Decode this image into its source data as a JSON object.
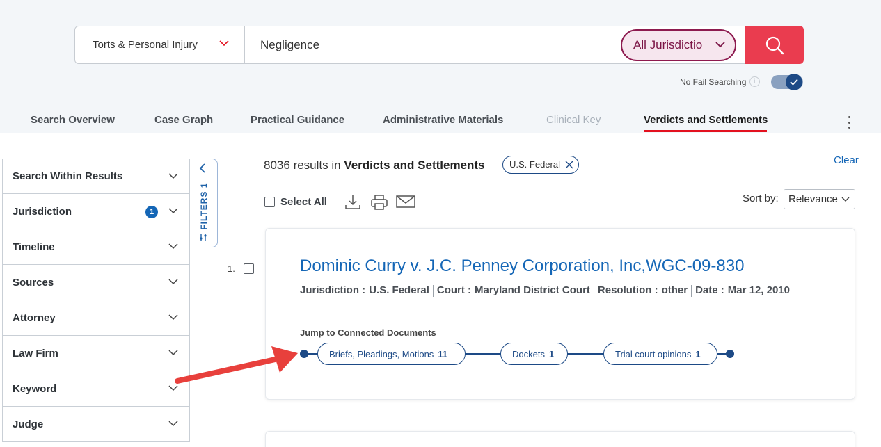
{
  "search": {
    "category": "Torts & Personal Injury",
    "query": "Negligence",
    "jurisdiction_button": "All Jurisdictio",
    "search_icon": "search-icon",
    "no_fail_label": "No Fail Searching",
    "no_fail_enabled": true
  },
  "tabs": [
    {
      "label": "Search Overview",
      "state": "normal"
    },
    {
      "label": "Case Graph",
      "state": "normal"
    },
    {
      "label": "Practical Guidance",
      "state": "normal"
    },
    {
      "label": "Administrative Materials",
      "state": "normal"
    },
    {
      "label": "Clinical Key",
      "state": "disabled"
    },
    {
      "label": "Verdicts and Settlements",
      "state": "active"
    }
  ],
  "filters_panel": {
    "label": "FILTERS",
    "count": "1",
    "items": [
      {
        "label": "Search Within Results"
      },
      {
        "label": "Jurisdiction",
        "badge": "1"
      },
      {
        "label": "Timeline"
      },
      {
        "label": "Sources"
      },
      {
        "label": "Attorney"
      },
      {
        "label": "Law Firm"
      },
      {
        "label": "Keyword"
      },
      {
        "label": "Judge"
      }
    ]
  },
  "results": {
    "count": "8036",
    "in_text": "results in",
    "section": "Verdicts and Settlements",
    "active_filter_chip": "U.S. Federal",
    "clear_label": "Clear",
    "select_all_label": "Select All",
    "sort_label": "Sort by:",
    "sort_value": "Relevance",
    "items": [
      {
        "number": "1.",
        "title": "Dominic Curry v. J.C. Penney Corporation, Inc,WGC-09-830",
        "meta": [
          {
            "key": "Jurisdiction :",
            "value": "U.S. Federal"
          },
          {
            "key": "Court :",
            "value": "Maryland District Court"
          },
          {
            "key": "Resolution :",
            "value": "other"
          },
          {
            "key": "Date :",
            "value": "Mar 12, 2010"
          }
        ],
        "jump_label": "Jump to Connected Documents",
        "connected": [
          {
            "label": "Briefs, Pleadings, Motions",
            "count": "11"
          },
          {
            "label": "Dockets",
            "count": "1"
          },
          {
            "label": "Trial court opinions",
            "count": "1"
          }
        ]
      }
    ]
  },
  "colors": {
    "accent_red": "#ea3c4f",
    "link_blue": "#1466b6",
    "navy": "#1d4a86",
    "jurisdiction_maroon": "#8d1a4f",
    "annotation_arrow": "#e8403c"
  }
}
